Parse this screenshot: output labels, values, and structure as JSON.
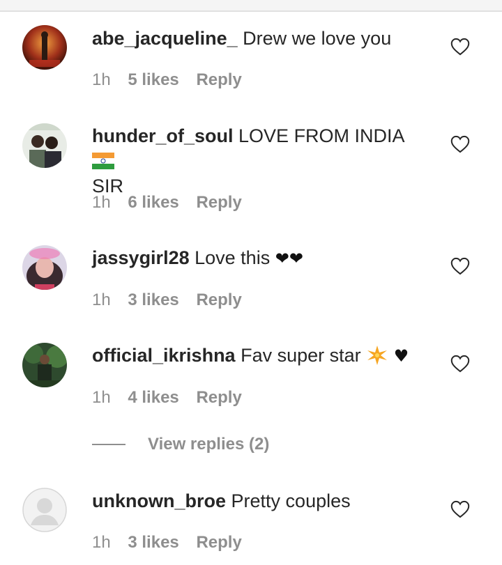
{
  "comments": [
    {
      "username": "abe_jacqueline_",
      "text": "Drew we love you",
      "time": "1h",
      "likes": "5 likes",
      "reply": "Reply"
    },
    {
      "username": "hunder_of_soul",
      "text": "LOVE FROM INDIA",
      "text2": "SIR",
      "time": "1h",
      "likes": "6 likes",
      "reply": "Reply"
    },
    {
      "username": "jassygirl28",
      "text": "Love this",
      "time": "1h",
      "likes": "3 likes",
      "reply": "Reply"
    },
    {
      "username": "official_ikrishna",
      "text": "Fav super star",
      "time": "1h",
      "likes": "4 likes",
      "reply": "Reply"
    },
    {
      "username": "unknown_broe",
      "text": "Pretty couples",
      "time": "1h",
      "likes": "3 likes",
      "reply": "Reply"
    }
  ],
  "view_replies": "View replies (2)",
  "icons": {
    "like": "heart-outline-icon",
    "flag": "india-flag-emoji",
    "sparkle": "sparkle-emoji"
  },
  "colors": {
    "text": "#262626",
    "meta": "#8e8e8e"
  }
}
